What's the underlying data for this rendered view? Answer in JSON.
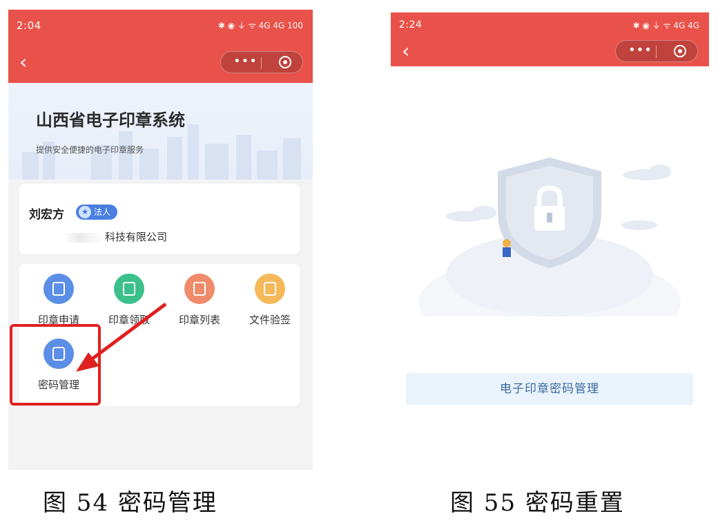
{
  "left_screen": {
    "status_bar": {
      "time": "2:04",
      "right_text": "✱ ◉ ⏚ ᯤ 4G 4G 100"
    },
    "app_title": "山西省电子印章系统",
    "app_subtitle": "提供安全便捷的电子印章服务",
    "user": {
      "name": "刘宏方",
      "role_badge": "法人",
      "company_visible": "科技有限公司"
    },
    "menu": [
      {
        "label": "印章申请",
        "icon": "seal-apply-icon",
        "color": "#5b8ee6"
      },
      {
        "label": "印章领取",
        "icon": "seal-receive-icon",
        "color": "#3cc08b"
      },
      {
        "label": "印章列表",
        "icon": "seal-list-icon",
        "color": "#ef8a6a"
      },
      {
        "label": "文件验签",
        "icon": "file-verify-icon",
        "color": "#f5b95a"
      },
      {
        "label": "密码管理",
        "icon": "lock-icon",
        "color": "#5b8ee6"
      }
    ],
    "highlight_color": "#e02020"
  },
  "right_screen": {
    "status_bar": {
      "time": "2:24",
      "right_text": "✱ ◉ ⏚ ᯤ 4G 4G"
    },
    "password_button": "电子印章密码管理"
  },
  "captions": {
    "left": "图 54  密码管理",
    "right": "图 55  密码重置"
  },
  "colors": {
    "topbar": "#e9524a",
    "accent": "#4a7fe0"
  }
}
